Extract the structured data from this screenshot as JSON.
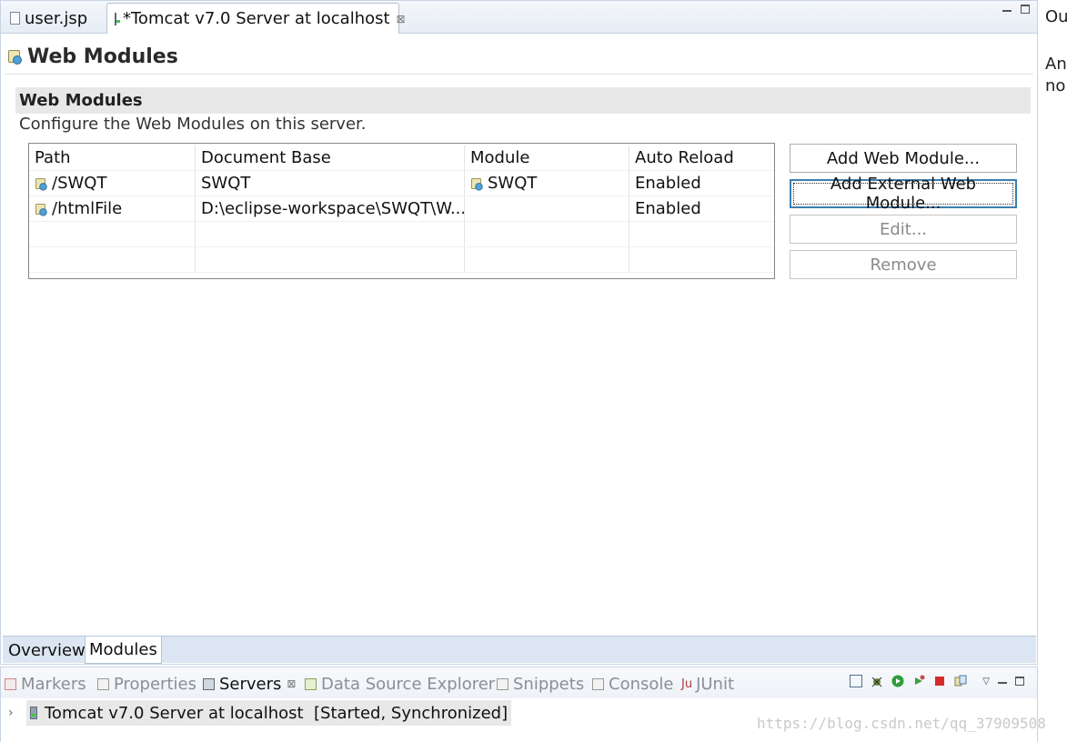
{
  "editor_tabs": [
    {
      "label": "user.jsp",
      "icon": "file-icon"
    },
    {
      "label": "*Tomcat v7.0 Server at localhost",
      "icon": "server-icon",
      "active": true
    }
  ],
  "page": {
    "title": "Web Modules",
    "section_title": "Web Modules",
    "section_description": "Configure the Web Modules on this server."
  },
  "table": {
    "headers": [
      "Path",
      "Document Base",
      "Module",
      "Auto Reload"
    ],
    "rows": [
      {
        "path": "/SWQT",
        "doc_base": "SWQT",
        "module": "SWQT",
        "auto_reload": "Enabled"
      },
      {
        "path": "/htmlFile",
        "doc_base": "D:\\eclipse-workspace\\SWQT\\W...",
        "module": "",
        "auto_reload": "Enabled"
      }
    ]
  },
  "buttons": {
    "add_web_module": "Add Web Module...",
    "add_external_web_module": "Add External Web Module...",
    "edit": "Edit...",
    "remove": "Remove"
  },
  "page_tabs": [
    "Overview",
    "Modules"
  ],
  "right_strip": [
    "Ou",
    "An",
    "no"
  ],
  "views": {
    "tabs": [
      "Markers",
      "Properties",
      "Servers",
      "Data Source Explorer",
      "Snippets",
      "Console",
      "JUnit"
    ],
    "active_tab": "Servers",
    "server_entry": "Tomcat v7.0 Server at localhost  [Started, Synchronized]"
  },
  "watermark": "https://blog.csdn.net/qq_37909508",
  "colors": {
    "accent_border": "#3c7fb1",
    "tab_strip": "#dbe6f2",
    "section_header": "#e8e8e8",
    "start_green": "#2f9e3a",
    "stop_red": "#d72b2b"
  }
}
